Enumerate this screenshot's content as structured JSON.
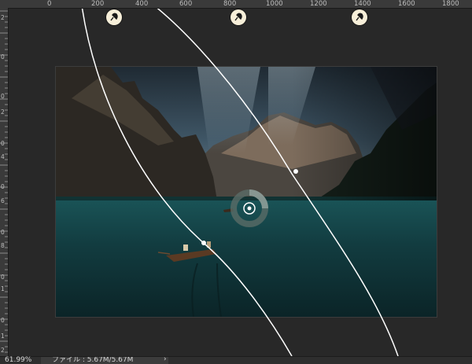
{
  "ruler": {
    "top_labels": [
      "0",
      "200",
      "400",
      "600",
      "800",
      "1000",
      "1200",
      "1400",
      "1600",
      "1800"
    ],
    "left_labels": [
      "2",
      "0",
      "0",
      "2",
      "0",
      "4",
      "0",
      "6",
      "0",
      "8",
      "0",
      "1",
      "0",
      "1",
      "2"
    ]
  },
  "status_bar": {
    "zoom": "61.99%",
    "file_info": "ファイル : 5.67M/5.67M",
    "arrow": "›"
  },
  "overlay": {
    "curve_color": "#ffffff",
    "pin_fill": "#f7efd9",
    "radial_ring_color": "#5a6b66"
  },
  "icons": {
    "pin_icon": "pin-icon",
    "radial_center_icon": "radial-center-icon"
  }
}
